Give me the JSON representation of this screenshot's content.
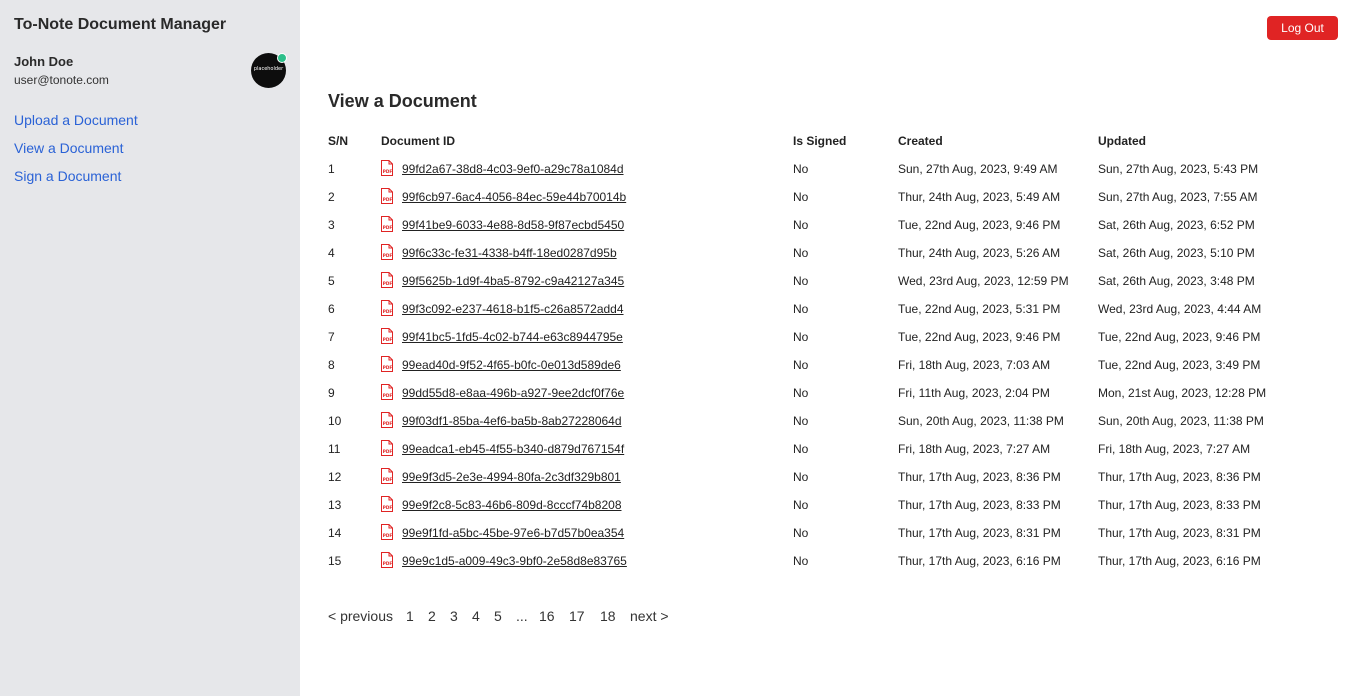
{
  "app": {
    "title": "To-Note Document Manager"
  },
  "user": {
    "name": "John Doe",
    "email": "user@tonote.com",
    "avatar_text": "placeholder",
    "status_color": "#2dbf8a"
  },
  "nav": [
    {
      "label": "Upload a Document"
    },
    {
      "label": "View a Document"
    },
    {
      "label": "Sign a Document"
    }
  ],
  "header": {
    "logout_label": "Log Out"
  },
  "page": {
    "title": "View a Document"
  },
  "table": {
    "columns": [
      "S/N",
      "Document ID",
      "Is Signed",
      "Created",
      "Updated"
    ],
    "file_icon": "pdf-file-icon",
    "rows": [
      {
        "sn": "1",
        "id": "99fd2a67-38d8-4c03-9ef0-a29c78a1084d",
        "signed": "No",
        "created": "Sun, 27th Aug, 2023, 9:49 AM",
        "updated": "Sun, 27th Aug, 2023, 5:43 PM"
      },
      {
        "sn": "2",
        "id": "99f6cb97-6ac4-4056-84ec-59e44b70014b",
        "signed": "No",
        "created": "Thur, 24th Aug, 2023, 5:49 AM",
        "updated": "Sun, 27th Aug, 2023, 7:55 AM"
      },
      {
        "sn": "3",
        "id": "99f41be9-6033-4e88-8d58-9f87ecbd5450",
        "signed": "No",
        "created": "Tue, 22nd Aug, 2023, 9:46 PM",
        "updated": "Sat, 26th Aug, 2023, 6:52 PM"
      },
      {
        "sn": "4",
        "id": "99f6c33c-fe31-4338-b4ff-18ed0287d95b",
        "signed": "No",
        "created": "Thur, 24th Aug, 2023, 5:26 AM",
        "updated": "Sat, 26th Aug, 2023, 5:10 PM"
      },
      {
        "sn": "5",
        "id": "99f5625b-1d9f-4ba5-8792-c9a42127a345",
        "signed": "No",
        "created": "Wed, 23rd Aug, 2023, 12:59 PM",
        "updated": "Sat, 26th Aug, 2023, 3:48 PM"
      },
      {
        "sn": "6",
        "id": "99f3c092-e237-4618-b1f5-c26a8572add4",
        "signed": "No",
        "created": "Tue, 22nd Aug, 2023, 5:31 PM",
        "updated": "Wed, 23rd Aug, 2023, 4:44 AM"
      },
      {
        "sn": "7",
        "id": "99f41bc5-1fd5-4c02-b744-e63c8944795e",
        "signed": "No",
        "created": "Tue, 22nd Aug, 2023, 9:46 PM",
        "updated": "Tue, 22nd Aug, 2023, 9:46 PM"
      },
      {
        "sn": "8",
        "id": "99ead40d-9f52-4f65-b0fc-0e013d589de6",
        "signed": "No",
        "created": "Fri, 18th Aug, 2023, 7:03 AM",
        "updated": "Tue, 22nd Aug, 2023, 3:49 PM"
      },
      {
        "sn": "9",
        "id": "99dd55d8-e8aa-496b-a927-9ee2dcf0f76e",
        "signed": "No",
        "created": "Fri, 11th Aug, 2023, 2:04 PM",
        "updated": "Mon, 21st Aug, 2023, 12:28 PM"
      },
      {
        "sn": "10",
        "id": "99f03df1-85ba-4ef6-ba5b-8ab27228064d",
        "signed": "No",
        "created": "Sun, 20th Aug, 2023, 11:38 PM",
        "updated": "Sun, 20th Aug, 2023, 11:38 PM"
      },
      {
        "sn": "11",
        "id": "99eadca1-eb45-4f55-b340-d879d767154f",
        "signed": "No",
        "created": "Fri, 18th Aug, 2023, 7:27 AM",
        "updated": "Fri, 18th Aug, 2023, 7:27 AM"
      },
      {
        "sn": "12",
        "id": "99e9f3d5-2e3e-4994-80fa-2c3df329b801",
        "signed": "No",
        "created": "Thur, 17th Aug, 2023, 8:36 PM",
        "updated": "Thur, 17th Aug, 2023, 8:36 PM"
      },
      {
        "sn": "13",
        "id": "99e9f2c8-5c83-46b6-809d-8cccf74b8208",
        "signed": "No",
        "created": "Thur, 17th Aug, 2023, 8:33 PM",
        "updated": "Thur, 17th Aug, 2023, 8:33 PM"
      },
      {
        "sn": "14",
        "id": "99e9f1fd-a5bc-45be-97e6-b7d57b0ea354",
        "signed": "No",
        "created": "Thur, 17th Aug, 2023, 8:31 PM",
        "updated": "Thur, 17th Aug, 2023, 8:31 PM"
      },
      {
        "sn": "15",
        "id": "99e9c1d5-a009-49c3-9bf0-2e58d8e83765",
        "signed": "No",
        "created": "Thur, 17th Aug, 2023, 6:16 PM",
        "updated": "Thur, 17th Aug, 2023, 6:16 PM"
      }
    ]
  },
  "pagination": {
    "previous_label": "< previous",
    "next_label": "next >",
    "pages": [
      "1",
      "2",
      "3",
      "4",
      "5",
      "...",
      "16",
      "17",
      "18"
    ]
  },
  "colors": {
    "sidebar_bg": "#e6e7ea",
    "link": "#2a62d6",
    "logout": "#e02424",
    "pdf_icon": "#e02424"
  }
}
